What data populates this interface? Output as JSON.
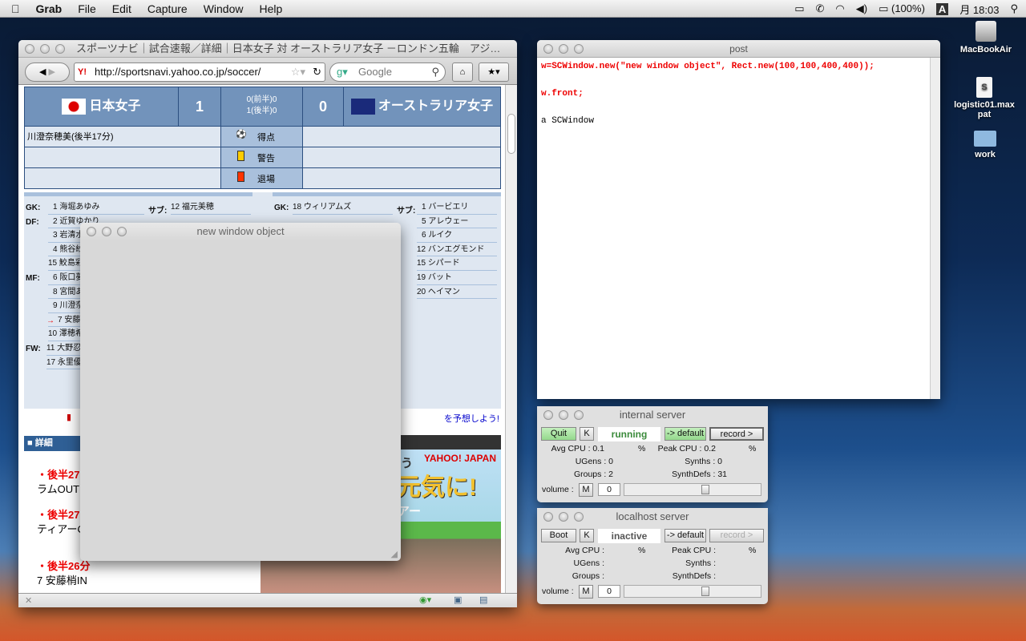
{
  "menubar": {
    "app": "Grab",
    "items": [
      "File",
      "Edit",
      "Capture",
      "Window",
      "Help"
    ],
    "battery": "(100%)",
    "input_method": "A",
    "clock": "月 18:03"
  },
  "browser": {
    "title": "スポーツナビ｜試合速報／詳細｜日本女子 対 オーストラリア女子 －ロンドン五輪　アジ…",
    "url": "http://sportsnavi.yahoo.co.jp/soccer/",
    "search_placeholder": "Google",
    "score": {
      "home": "日本女子",
      "home_score": "1",
      "half1": "0(前半)0",
      "half2": "1(後半)0",
      "away_score": "0",
      "away": "オーストラリア女子"
    },
    "events": {
      "goal_label": "得点",
      "yellow_label": "警告",
      "red_label": "退場",
      "home_goal": "川澄奈穂美(後半17分)"
    },
    "lineup": {
      "home": [
        {
          "pos": "GK:",
          "p": "1 海堀あゆみ"
        },
        {
          "pos": "DF:",
          "p": "2 近賀ゆかり"
        },
        {
          "pos": "",
          "p": "3 岩清水"
        },
        {
          "pos": "",
          "p": "4 熊谷紗"
        },
        {
          "pos": "",
          "p": "15 鮫島彩"
        },
        {
          "pos": "MF:",
          "p": "6 阪口夢"
        },
        {
          "pos": "",
          "p": "8 宮間あ"
        },
        {
          "pos": "",
          "p": "9 川澄奈"
        },
        {
          "pos": "→",
          "p": "7 安藤"
        },
        {
          "pos": "",
          "p": "10 澤穂希"
        },
        {
          "pos": "FW:",
          "p": "11 大野忍"
        },
        {
          "pos": "",
          "p": "17 永里優"
        }
      ],
      "home_sub_label": "サブ:",
      "home_subs": [
        "12 福元美穂"
      ],
      "away": [
        {
          "pos": "GK:",
          "p": "18 ウィリアムズ"
        }
      ],
      "away_sub_label": "サブ:",
      "away_subs": [
        "1 バービエリ",
        "5 アレウェー",
        "6 ルイク",
        "12 バンエグモンド",
        "15 シパード",
        "19 バット",
        "20 ヘイマン"
      ]
    },
    "notice": "を予想しよう!",
    "detail_header": "■ 詳細",
    "details": [
      {
        "time": "・後半27",
        "text": "ラムOUT"
      },
      {
        "time": "・後半27",
        "text": "ティアーO"
      },
      {
        "time": "・後半26分",
        "text": "7 安藤梢IN"
      }
    ],
    "ad": {
      "top": "を楽しもう",
      "brand": "YAHOO! JAPAN",
      "main": "元気に!",
      "sub": "ィアツアー"
    }
  },
  "new_window": {
    "title": "new window object"
  },
  "post": {
    "title": "post",
    "lines": [
      "w=SCWindow.new(\"new window object\", Rect.new(100,100,400,400));",
      "",
      "w.front;",
      "",
      "a SCWindow"
    ]
  },
  "internal": {
    "title": "internal server",
    "boot": "Quit",
    "k": "K",
    "status": "running",
    "default": "-> default",
    "record": "record >",
    "avg_cpu": "Avg CPU : 0.1",
    "avg_pct": "%",
    "peak_cpu": "Peak CPU : 0.2",
    "peak_pct": "%",
    "ugens": "UGens : 0",
    "synths": "Synths : 0",
    "groups": "Groups : 2",
    "synthdefs": "SynthDefs : 31",
    "volume": "volume :",
    "m": "M",
    "vol_value": "0",
    "volume_slider": 0.6
  },
  "localhost": {
    "title": "localhost server",
    "boot": "Boot",
    "k": "K",
    "status": "inactive",
    "default": "-> default",
    "record": "record >",
    "avg_cpu": "Avg CPU :",
    "avg_pct": "%",
    "peak_cpu": "Peak CPU :",
    "peak_pct": "%",
    "ugens": "UGens :",
    "synths": "Synths :",
    "groups": "Groups :",
    "synthdefs": "SynthDefs :",
    "volume": "volume :",
    "m": "M",
    "vol_value": "0",
    "volume_slider": 0.6
  },
  "desktop": [
    "MacBookAir",
    "logistic01.maxpat",
    "work"
  ],
  "colors": {
    "header_blue": "#7293bb",
    "running_green": "#3a8a3a",
    "button_green": "#a6e0a0",
    "code_red": "#e00000"
  }
}
